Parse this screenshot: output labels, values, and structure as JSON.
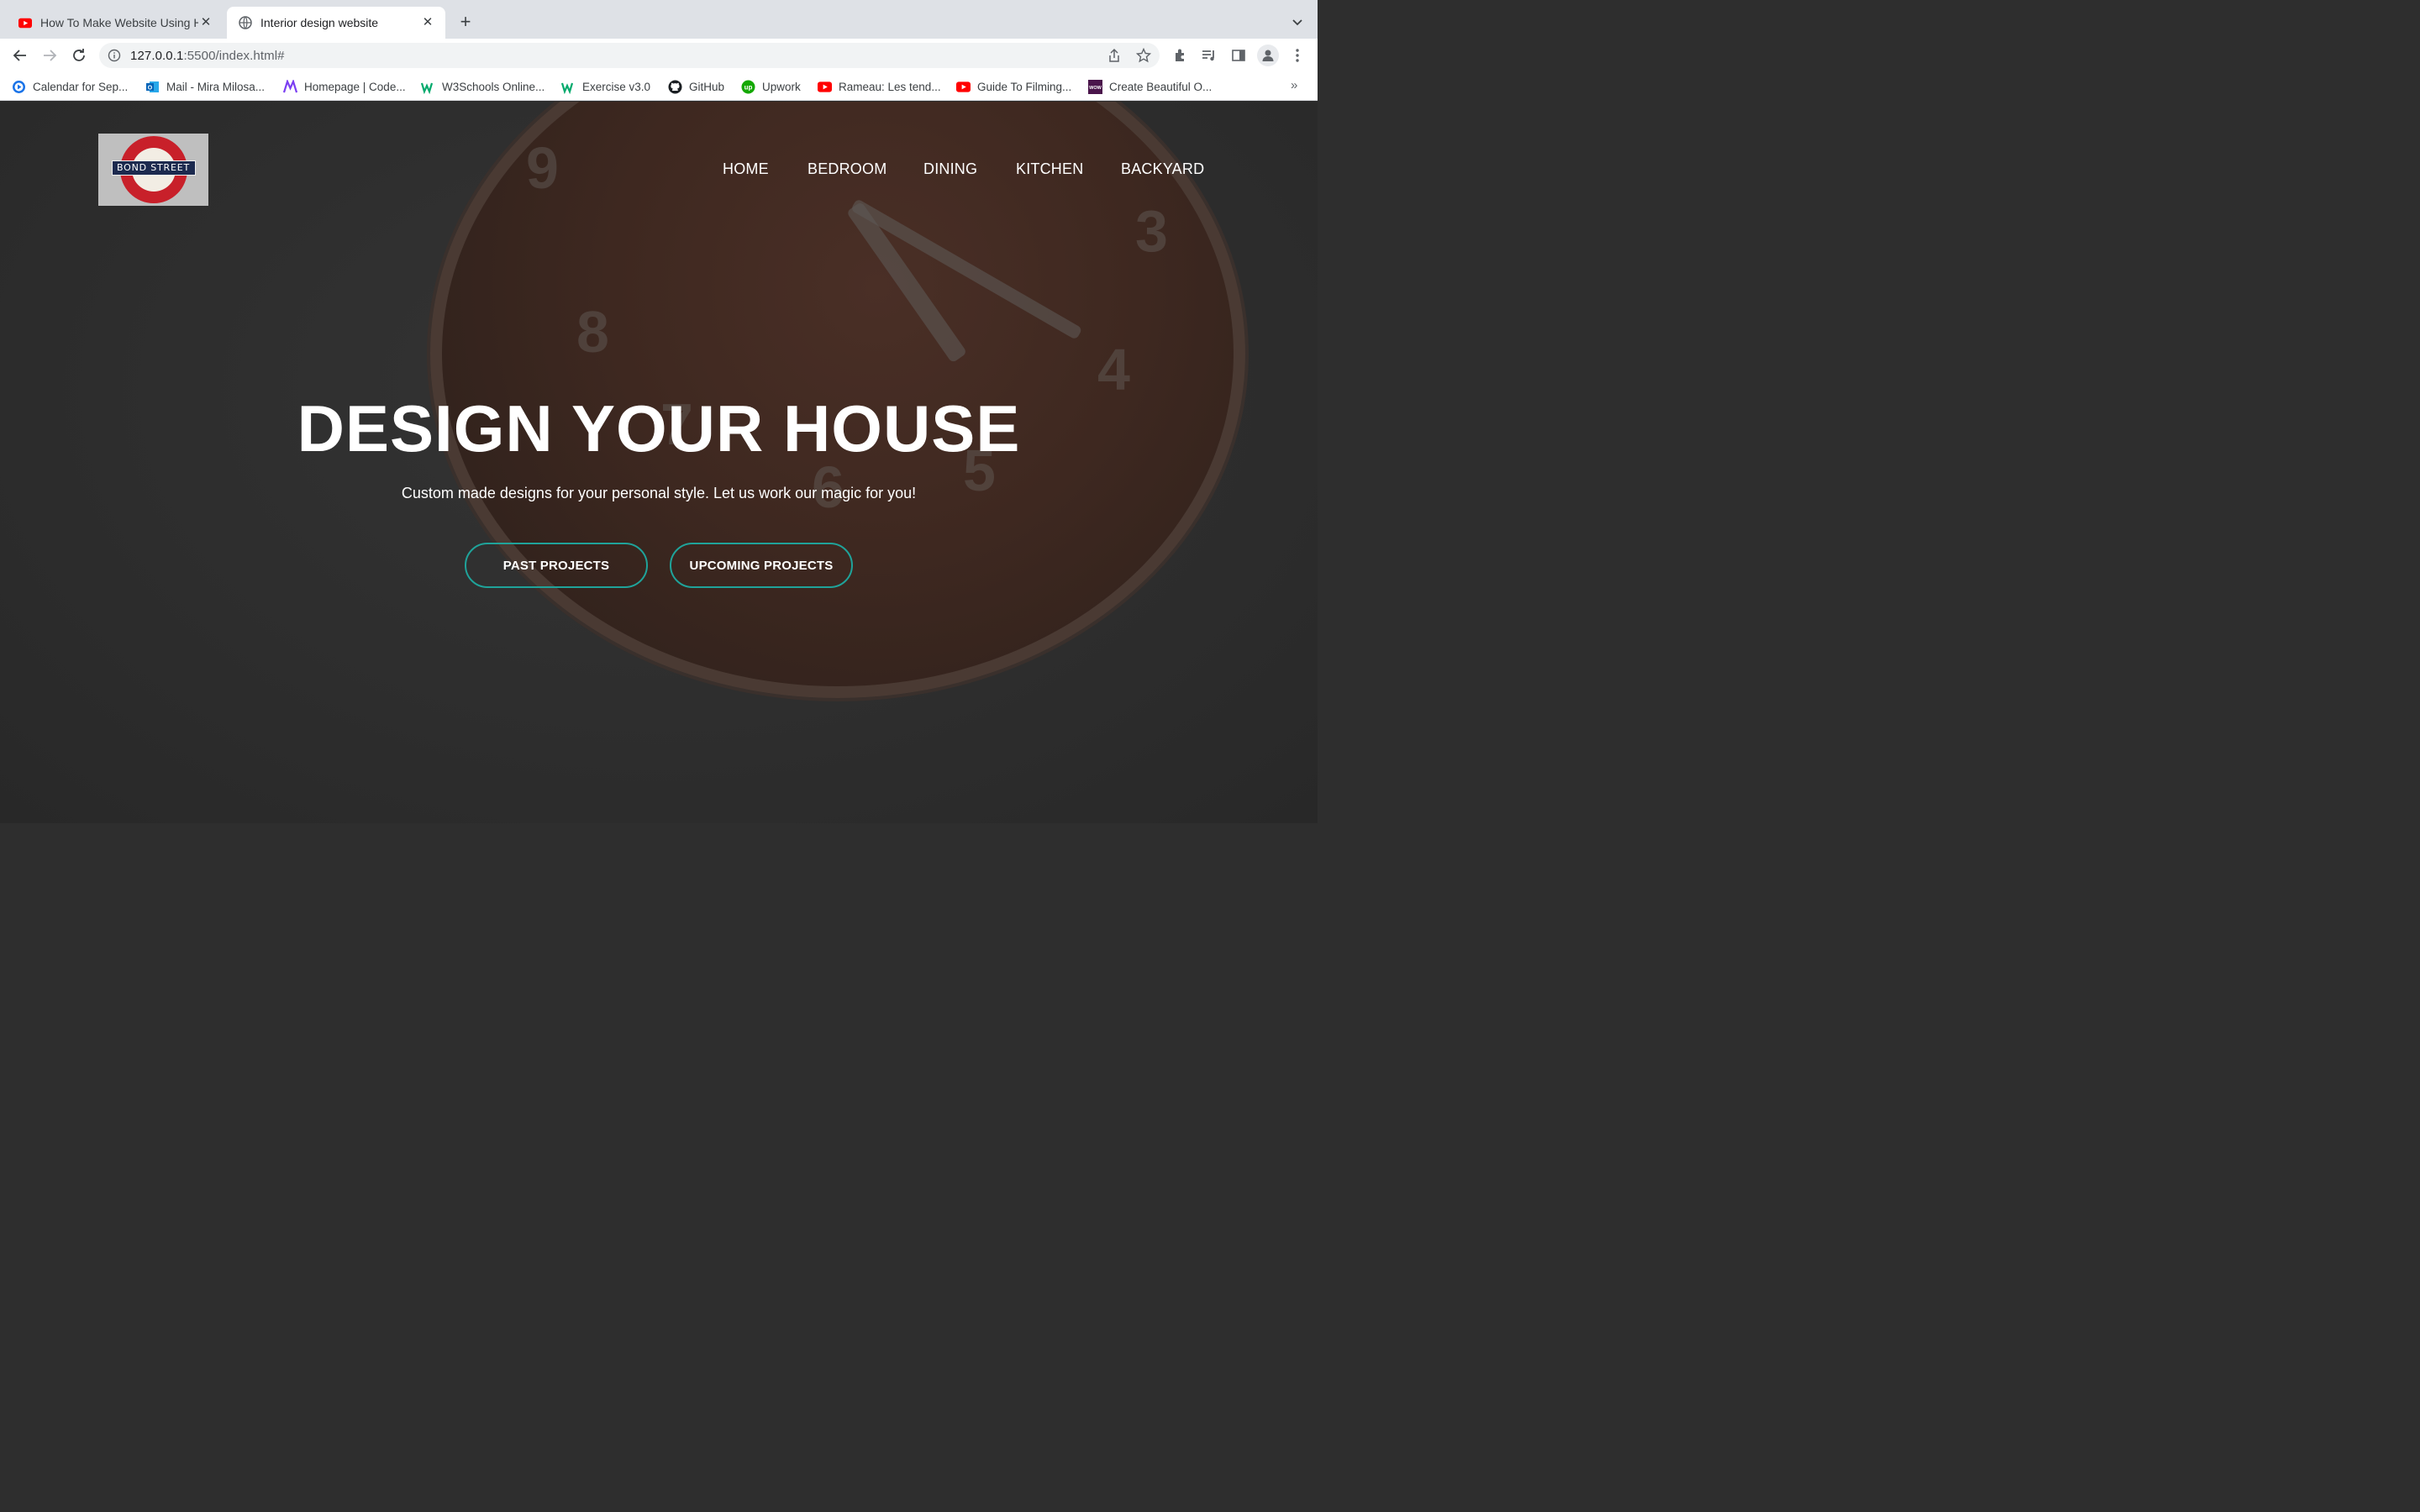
{
  "browser": {
    "tabs": [
      {
        "title": "How To Make Website Using HTML",
        "active": false,
        "icon": "youtube-icon"
      },
      {
        "title": "Interior design website",
        "active": true,
        "icon": "globe-icon"
      }
    ],
    "new_tab_label": "+",
    "url_host": "127.0.0.1",
    "url_rest": ":5500/index.html#",
    "bookmarks": [
      {
        "label": "Calendar for Sep...",
        "icon": "calendar-icon"
      },
      {
        "label": "Mail - Mira Milosa...",
        "icon": "outlook-icon"
      },
      {
        "label": "Homepage | Code...",
        "icon": "codecademy-icon"
      },
      {
        "label": "W3Schools Online...",
        "icon": "w3schools-icon"
      },
      {
        "label": "Exercise v3.0",
        "icon": "w3schools-icon"
      },
      {
        "label": "GitHub",
        "icon": "github-icon"
      },
      {
        "label": "Upwork",
        "icon": "upwork-icon"
      },
      {
        "label": "Rameau: Les tend...",
        "icon": "youtube-icon"
      },
      {
        "label": "Guide To Filming...",
        "icon": "youtube-icon"
      },
      {
        "label": "Create Beautiful O...",
        "icon": "wow-icon"
      }
    ],
    "bookmarks_more": "»"
  },
  "site": {
    "logo_text": "BOND STREET",
    "nav": [
      "HOME",
      "BEDROOM",
      "DINING",
      "KITCHEN",
      "BACKYARD"
    ],
    "headline": "DESIGN YOUR HOUSE",
    "subtitle": "Custom made designs for your personal style. Let us work our magic for you!",
    "buttons": [
      "PAST PROJECTS",
      "UPCOMING PROJECTS"
    ],
    "accent_color": "#1fa39a"
  }
}
